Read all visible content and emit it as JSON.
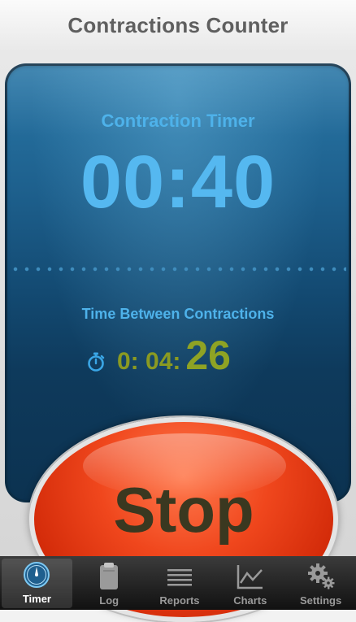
{
  "header": {
    "title": "Contractions Counter"
  },
  "timer": {
    "label": "Contraction Timer",
    "value": "00:40"
  },
  "between": {
    "label": "Time Between Contractions",
    "hours_minutes": "0: 04:",
    "seconds": "26",
    "icon": "stopwatch-icon"
  },
  "stop_button": {
    "label": "Stop"
  },
  "tabs": [
    {
      "label": "Timer",
      "icon": "timer-icon",
      "active": true
    },
    {
      "label": "Log",
      "icon": "clipboard-icon",
      "active": false
    },
    {
      "label": "Reports",
      "icon": "list-icon",
      "active": false
    },
    {
      "label": "Charts",
      "icon": "line-chart-icon",
      "active": false
    },
    {
      "label": "Settings",
      "icon": "gear-icon",
      "active": false
    }
  ],
  "colors": {
    "accent_blue": "#4eb2ea",
    "olive": "#8fa324",
    "stop_red": "#f0471d"
  }
}
